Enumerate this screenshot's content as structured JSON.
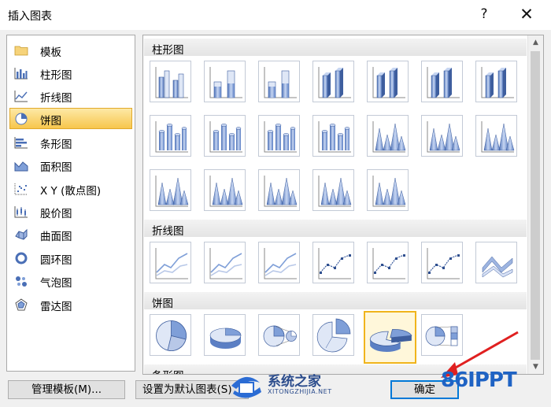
{
  "dialog": {
    "title": "插入图表",
    "help_glyph": "?",
    "close_glyph": "✕"
  },
  "sidebar": {
    "items": [
      {
        "label": "模板",
        "icon": "folder-icon"
      },
      {
        "label": "柱形图",
        "icon": "column-chart-icon"
      },
      {
        "label": "折线图",
        "icon": "line-chart-icon"
      },
      {
        "label": "饼图",
        "icon": "pie-chart-icon",
        "selected": true
      },
      {
        "label": "条形图",
        "icon": "bar-chart-icon"
      },
      {
        "label": "面积图",
        "icon": "area-chart-icon"
      },
      {
        "label": "X Y (散点图)",
        "icon": "scatter-chart-icon"
      },
      {
        "label": "股价图",
        "icon": "stock-chart-icon"
      },
      {
        "label": "曲面图",
        "icon": "surface-chart-icon"
      },
      {
        "label": "圆环图",
        "icon": "doughnut-chart-icon"
      },
      {
        "label": "气泡图",
        "icon": "bubble-chart-icon"
      },
      {
        "label": "雷达图",
        "icon": "radar-chart-icon"
      }
    ]
  },
  "gallery": {
    "sections": [
      {
        "label": "柱形图"
      },
      {
        "label": "折线图"
      },
      {
        "label": "饼图"
      },
      {
        "label": "条形图"
      }
    ],
    "selected_thumbnail": "饼图-4"
  },
  "buttons": {
    "manage_templates": "管理模板(M)...",
    "set_default": "设置为默认图表(S)",
    "ok": "确定"
  },
  "watermarks": {
    "site1_text": "系统之家",
    "site1_url": "XITONGZHIJIA.NET",
    "site2_text": "86IPPT"
  },
  "colors": {
    "selected_fill": "#f7c64c",
    "accent": "#0078d7",
    "chart_blue": "#7f9fd8"
  }
}
